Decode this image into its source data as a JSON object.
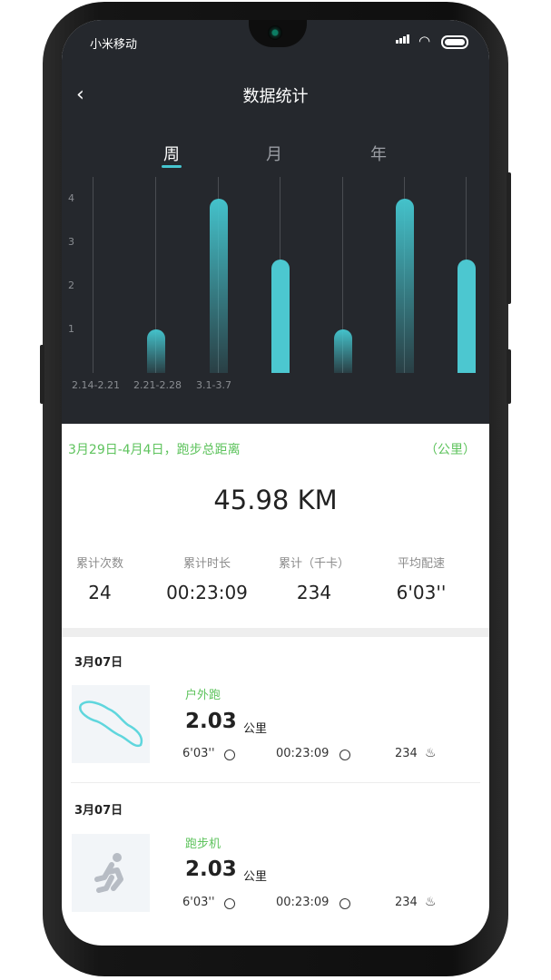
{
  "status_bar": {
    "carrier": "小米移动"
  },
  "header": {
    "back_glyph": "‹",
    "title": "数据统计"
  },
  "tabs": [
    {
      "label": "周",
      "active": true
    },
    {
      "label": "月",
      "active": false
    },
    {
      "label": "年",
      "active": false
    }
  ],
  "chart_data": {
    "type": "bar",
    "y_ticks": [
      "1",
      "2",
      "3",
      "4"
    ],
    "categories": [
      "2.14-2.21",
      "2.21-2.28",
      "3.1-3.7",
      "",
      "",
      "",
      ""
    ],
    "values": [
      0,
      1,
      4,
      2.6,
      1,
      4,
      2.6
    ],
    "ylim": [
      0,
      4.2
    ],
    "styles": [
      "gradient",
      "gradient",
      "gradient",
      "solid",
      "gradient",
      "gradient",
      "solid"
    ],
    "bar_color": "#4cc7d0",
    "grid": true
  },
  "summary": {
    "range_label": "3月29日-4月4日，跑步总距离",
    "unit_label": "（公里）",
    "total": "45.98 KM",
    "stats": [
      {
        "label": "累计次数",
        "value": "24"
      },
      {
        "label": "累计时长",
        "value": "00:23:09"
      },
      {
        "label": "累计（千卡）",
        "value": "234"
      },
      {
        "label": "平均配速",
        "value": "6'03''"
      }
    ]
  },
  "records": [
    {
      "date": "3月07日",
      "type": "户外跑",
      "distance": "2.03",
      "unit": "公里",
      "pace": "6'03''",
      "duration": "00:23:09",
      "calories": "234",
      "thumb": "route-map"
    },
    {
      "date": "3月07日",
      "type": "跑步机",
      "distance": "2.03",
      "unit": "公里",
      "pace": "6'03''",
      "duration": "00:23:09",
      "calories": "234",
      "thumb": "runner-icon"
    }
  ],
  "accent_color": "#5ec35d"
}
